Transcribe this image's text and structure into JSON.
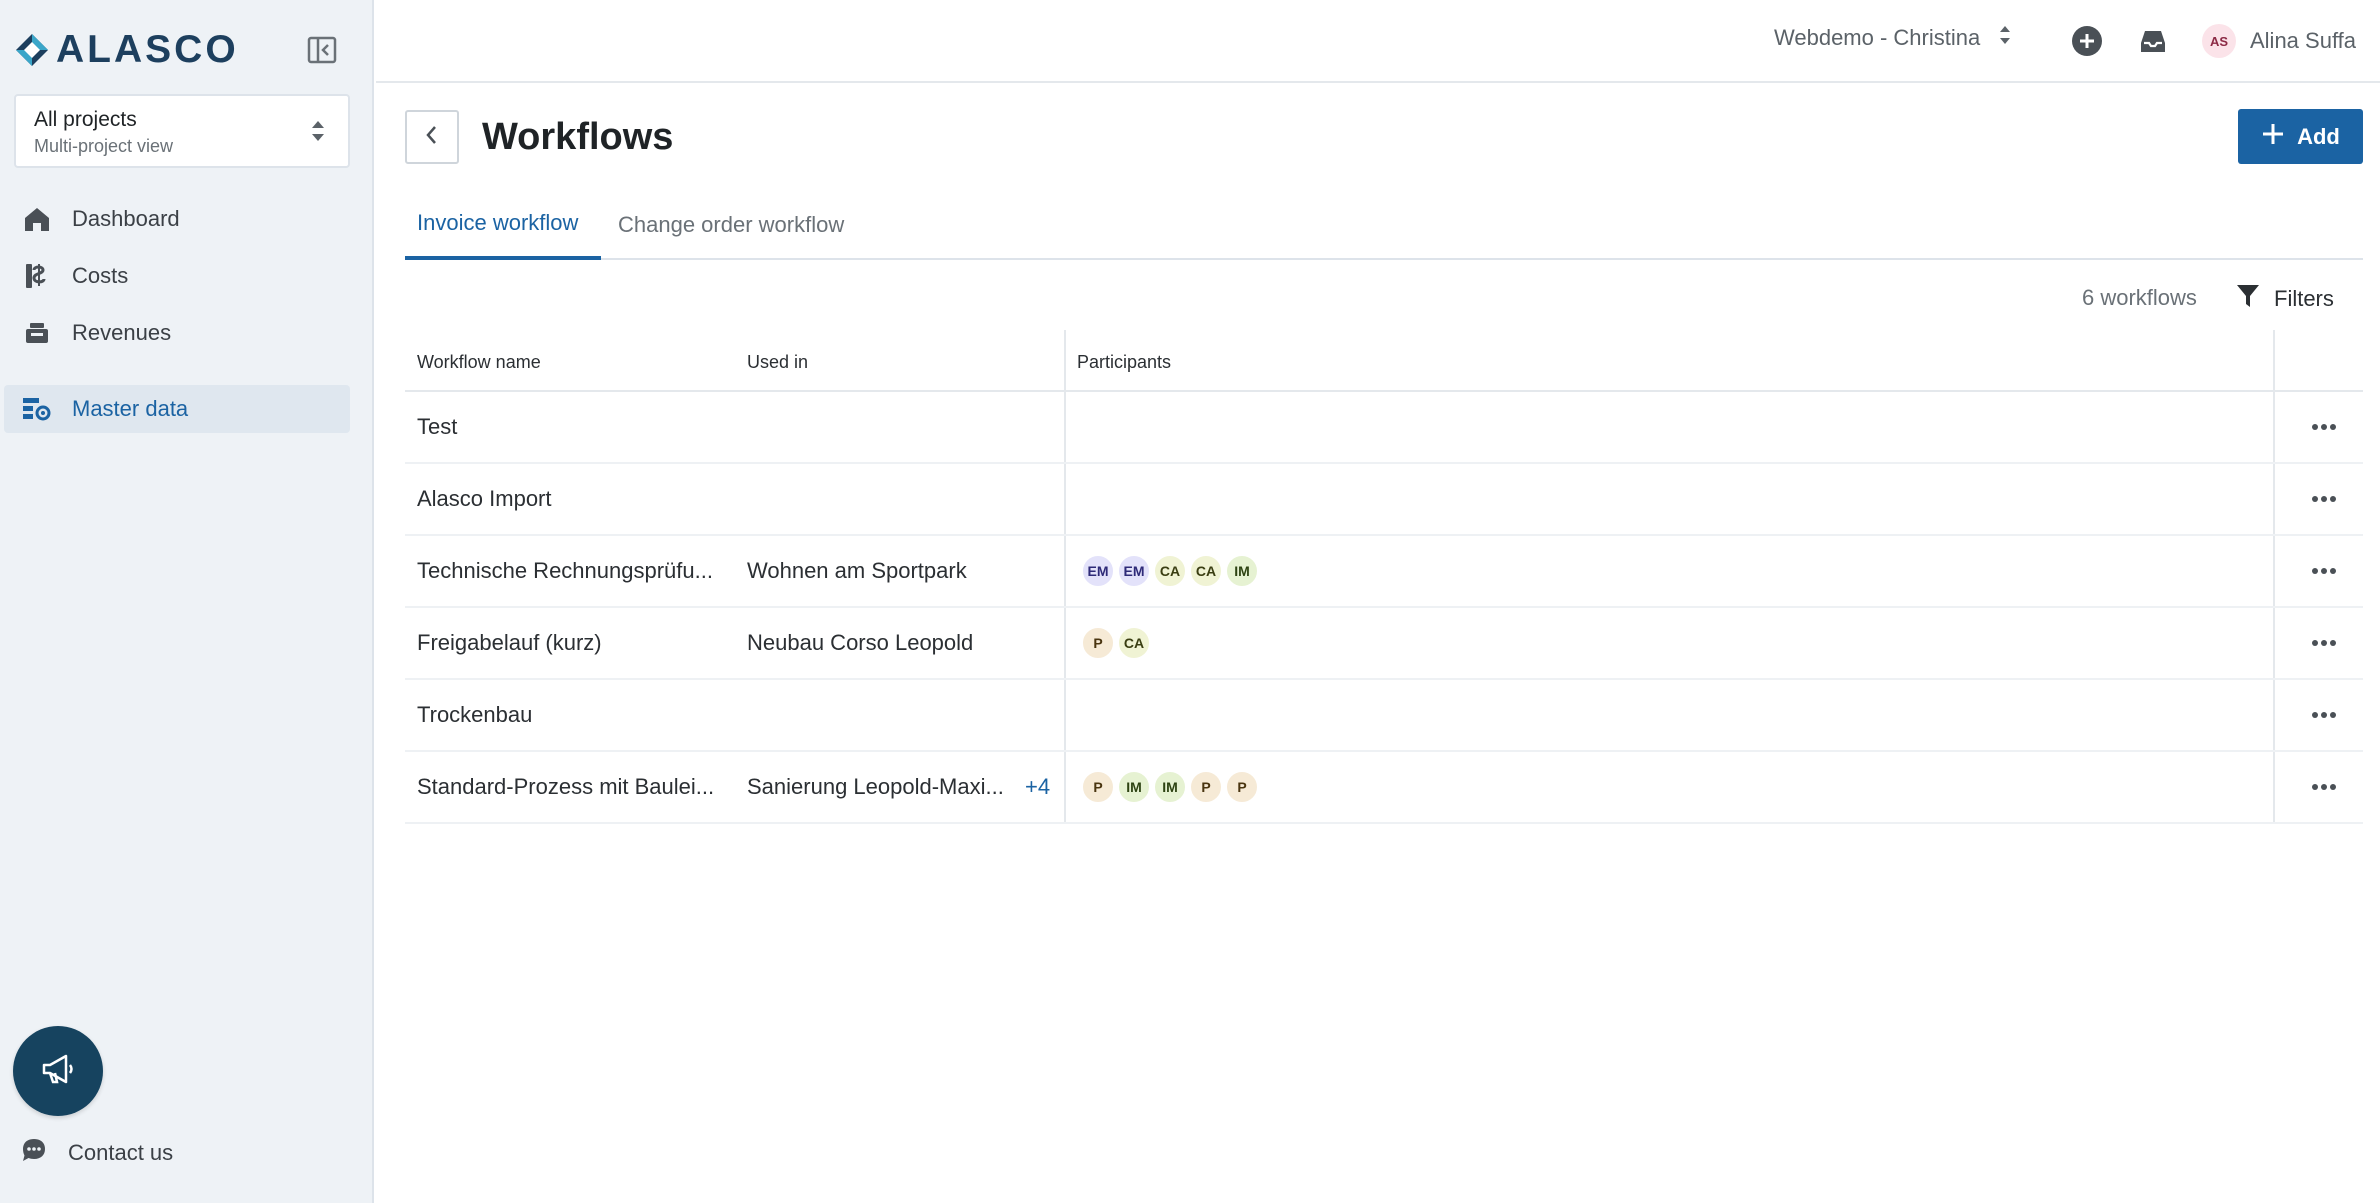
{
  "app": {
    "logo_text": "ALASCO",
    "brand_color": "#1b63a3"
  },
  "sidebar": {
    "project_select": {
      "title": "All projects",
      "subtitle": "Multi-project view"
    },
    "items": [
      {
        "label": "Dashboard",
        "icon": "home-icon"
      },
      {
        "label": "Costs",
        "icon": "costs-icon"
      },
      {
        "label": "Revenues",
        "icon": "revenues-icon"
      },
      {
        "label": "Master data",
        "icon": "master-data-icon",
        "active": true
      }
    ],
    "contact_label": "Contact us"
  },
  "topbar": {
    "org_label": "Webdemo - Christina",
    "user_initials": "AS",
    "user_name": "Alina Suffa"
  },
  "header": {
    "title": "Workflows",
    "add_label": "Add"
  },
  "tabs": [
    {
      "label": "Invoice workflow",
      "active": true
    },
    {
      "label": "Change order workflow",
      "active": false
    }
  ],
  "toolbar": {
    "count_label": "6 workflows",
    "filters_label": "Filters"
  },
  "table": {
    "columns": [
      "Workflow name",
      "Used in",
      "Participants"
    ],
    "rows": [
      {
        "name": "Test",
        "used_in": "",
        "more": "",
        "participants": []
      },
      {
        "name": "Alasco Import",
        "used_in": "",
        "more": "",
        "participants": []
      },
      {
        "name": "Technische Rechnungsprüfu...",
        "used_in": "Wohnen am Sportpark",
        "more": "",
        "participants": [
          "EM",
          "EM",
          "CA",
          "CA",
          "IM"
        ]
      },
      {
        "name": "Freigabelauf (kurz)",
        "used_in": "Neubau Corso Leopold",
        "more": "",
        "participants": [
          "P",
          "CA"
        ]
      },
      {
        "name": "Trockenbau",
        "used_in": "",
        "more": "",
        "participants": []
      },
      {
        "name": "Standard-Prozess mit Baulei...",
        "used_in": "Sanierung Leopold-Maxi...",
        "more": "+4",
        "participants": [
          "P",
          "IM",
          "IM",
          "P",
          "P"
        ]
      }
    ]
  }
}
